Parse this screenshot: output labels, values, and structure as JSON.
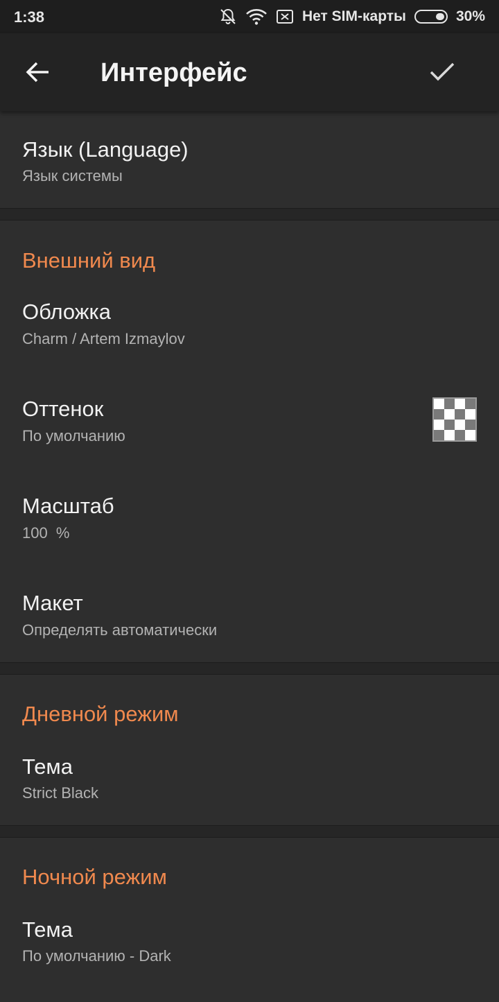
{
  "status_bar": {
    "time": "1:38",
    "carrier": "Нет SIM-карты",
    "battery": "30%",
    "icons": [
      "bell-off-icon",
      "wifi-icon",
      "no-sim-icon",
      "battery-icon"
    ]
  },
  "app_bar": {
    "title": "Интерфейс",
    "back_icon": "arrow-left-icon",
    "confirm_icon": "checkmark-icon"
  },
  "language": {
    "title": "Язык (Language)",
    "value": "Язык системы"
  },
  "appearance": {
    "header": "Внешний вид",
    "skin": {
      "title": "Обложка",
      "value": "Charm / Artem Izmaylov"
    },
    "tint": {
      "title": "Оттенок",
      "value": "По умолчанию",
      "swatch": "transparent-checker"
    },
    "scale": {
      "title": "Масштаб",
      "value": "100  %"
    },
    "layout": {
      "title": "Макет",
      "value": "Определять автоматически"
    }
  },
  "day_mode": {
    "header": "Дневной режим",
    "theme": {
      "title": "Тема",
      "value": "Strict Black"
    }
  },
  "night_mode": {
    "header": "Ночной режим",
    "theme": {
      "title": "Тема",
      "value": "По умолчанию - Dark"
    }
  },
  "colors": {
    "accent": "#f0894e",
    "background": "#2e2e2e",
    "app_bar": "#232323",
    "status_bar": "#1e1e1e"
  }
}
